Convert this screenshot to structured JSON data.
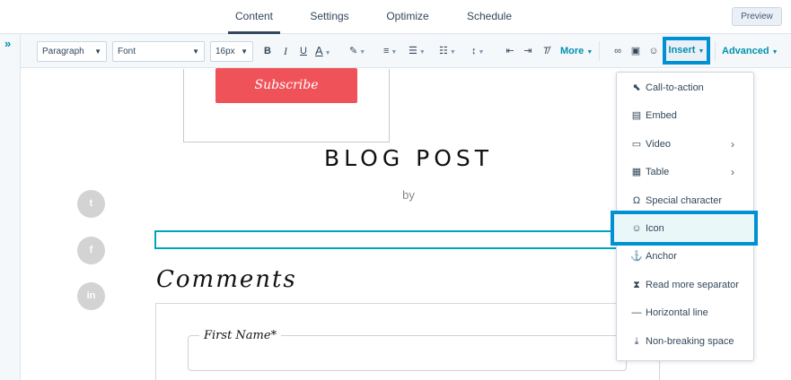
{
  "tabs": [
    "Content",
    "Settings",
    "Optimize",
    "Schedule"
  ],
  "active_tab": "Content",
  "preview_label": "Preview",
  "rail_toggle": "»",
  "toolbar": {
    "paragraph": "Paragraph",
    "font": "Font",
    "size": "16px",
    "bold": "B",
    "italic": "I",
    "underline": "U",
    "text_color": "A",
    "more": "More",
    "insert": "Insert",
    "advanced": "Advanced"
  },
  "canvas": {
    "subscribe": "Subscribe",
    "blog_title": "BLOG POST",
    "byline": "by",
    "social": [
      "t",
      "f",
      "in"
    ],
    "comments": "Comments",
    "first_name_label": "First Name*"
  },
  "insert_menu": [
    {
      "label": "Call-to-action",
      "icon": "cta-icon"
    },
    {
      "label": "Embed",
      "icon": "embed-icon"
    },
    {
      "label": "Video",
      "icon": "video-icon",
      "submenu": true
    },
    {
      "label": "Table",
      "icon": "table-icon",
      "submenu": true
    },
    {
      "label": "Special character",
      "icon": "omega-icon"
    },
    {
      "label": "Icon",
      "icon": "smiley-icon",
      "highlighted": true
    },
    {
      "label": "Anchor",
      "icon": "anchor-icon"
    },
    {
      "label": "Read more separator",
      "icon": "read-more-icon"
    },
    {
      "label": "Horizontal line",
      "icon": "horizontal-line-icon"
    },
    {
      "label": "Non-breaking space",
      "icon": "nbsp-icon"
    }
  ],
  "colors": {
    "accent": "#0091ae",
    "highlight_border": "#0091d5",
    "subscribe_button": "#f0525a",
    "selection_outline": "#00a4bd"
  }
}
